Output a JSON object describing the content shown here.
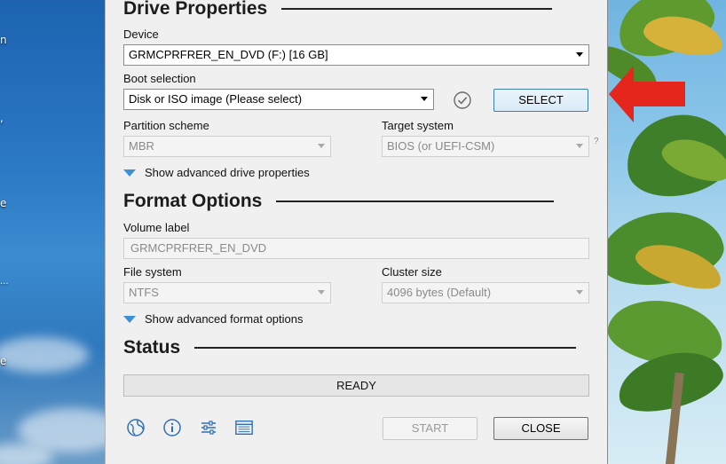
{
  "drive_properties": {
    "title": "Drive Properties",
    "device_label": "Device",
    "device_value": "GRMCPRFRER_EN_DVD (F:) [16 GB]",
    "boot_label": "Boot selection",
    "boot_value": "Disk or ISO image (Please select)",
    "select_button": "SELECT",
    "partition_label": "Partition scheme",
    "partition_value": "MBR",
    "target_label": "Target system",
    "target_value": "BIOS (or UEFI-CSM)",
    "target_help": "?",
    "advanced_drive": "Show advanced drive properties"
  },
  "format_options": {
    "title": "Format Options",
    "volume_label": "Volume label",
    "volume_value": "GRMCPRFRER_EN_DVD",
    "fs_label": "File system",
    "fs_value": "NTFS",
    "cluster_label": "Cluster size",
    "cluster_value": "4096 bytes (Default)",
    "advanced_format": "Show advanced format options"
  },
  "status": {
    "title": "Status",
    "text": "READY"
  },
  "footer": {
    "start_button": "START",
    "close_button": "CLOSE",
    "icons": [
      "globe-icon",
      "info-icon",
      "settings-sliders-icon",
      "log-icon"
    ]
  },
  "colors": {
    "dialog_bg": "#f0f0f0",
    "accent_blue": "#3d8fd6",
    "annotation_red": "#e4261c"
  }
}
